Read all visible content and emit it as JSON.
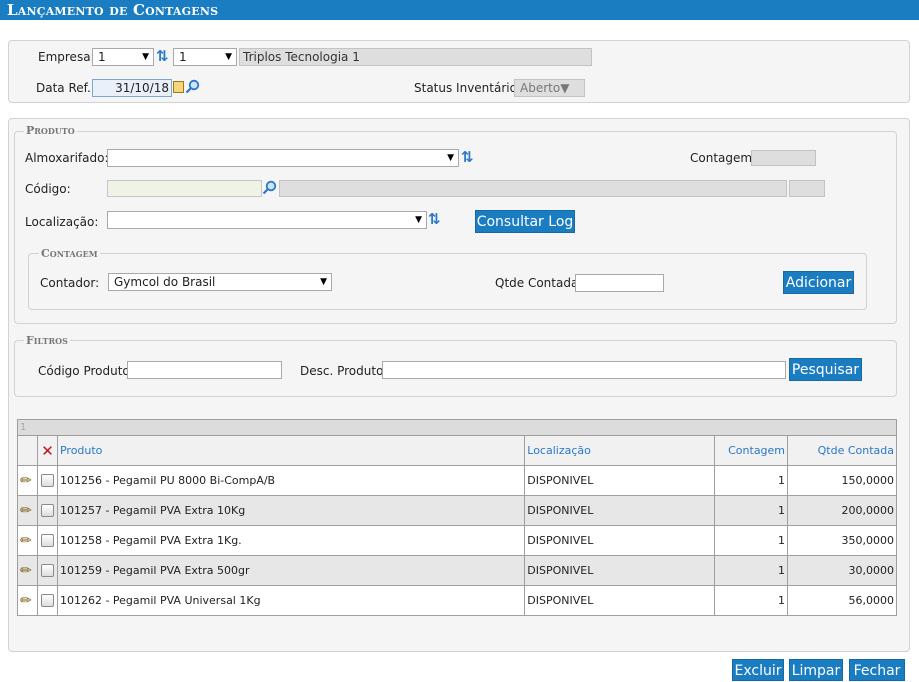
{
  "title": "Lançamento de Contagens",
  "header": {
    "empresa_label": "Empresa:",
    "empresa_value": "1",
    "filial_value": "1",
    "empresa_name": "Triplos Tecnologia 1",
    "data_ref_label": "Data Ref.:",
    "data_ref_value": "31/10/18",
    "status_label": "Status Inventário:",
    "status_value": "Aberto"
  },
  "produto": {
    "legend": "Produto",
    "almox_label": "Almoxarifado:",
    "almox_value": "",
    "contagem_label": "Contagem:",
    "codigo_label": "Código:",
    "localizacao_label": "Localização:",
    "consultar_log": "Consultar Log"
  },
  "contagem": {
    "legend": "Contagem",
    "contador_label": "Contador:",
    "contador_value": "Gymcol do Brasil",
    "qtde_label": "Qtde Contada:",
    "adicionar": "Adicionar"
  },
  "filtros": {
    "legend": "Filtros",
    "codigo_label": "Código Produto:",
    "desc_label": "Desc. Produto:",
    "pesquisar": "Pesquisar"
  },
  "grid": {
    "page": "1",
    "columns": [
      "Produto",
      "Localização",
      "Contagem",
      "Qtde Contada"
    ],
    "rows": [
      {
        "produto": "101256 - Pegamil PU 8000 Bi-CompA/B",
        "localizacao": "DISPONIVEL",
        "contagem": "1",
        "qtde": "150,0000"
      },
      {
        "produto": "101257 - Pegamil PVA Extra 10Kg",
        "localizacao": "DISPONIVEL",
        "contagem": "1",
        "qtde": "200,0000"
      },
      {
        "produto": "101258 - Pegamil PVA Extra 1Kg.",
        "localizacao": "DISPONIVEL",
        "contagem": "1",
        "qtde": "350,0000"
      },
      {
        "produto": "101259 - Pegamil PVA Extra 500gr",
        "localizacao": "DISPONIVEL",
        "contagem": "1",
        "qtde": "30,0000"
      },
      {
        "produto": "101262 - Pegamil PVA Universal 1Kg",
        "localizacao": "DISPONIVEL",
        "contagem": "1",
        "qtde": "56,0000"
      }
    ]
  },
  "footer": {
    "excluir": "Excluir",
    "limpar": "Limpar",
    "fechar": "Fechar"
  },
  "colors": {
    "accent": "#1a7cc1",
    "link": "#2a78c8"
  },
  "icons": {
    "refresh": "refresh-icon",
    "search": "search-icon",
    "calendar": "calendar-icon",
    "edit": "pencil-icon",
    "delete": "delete-x-icon"
  }
}
